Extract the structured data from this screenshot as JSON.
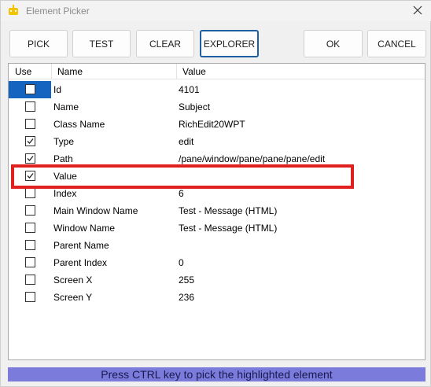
{
  "window": {
    "title": "Element Picker",
    "app_icon": "robot-icon",
    "close_icon": "close-icon"
  },
  "toolbar": {
    "pick_label": "PICK",
    "test_label": "TEST",
    "clear_label": "CLEAR",
    "explorer_label": "EXPLORER",
    "ok_label": "OK",
    "cancel_label": "CANCEL",
    "active": "EXPLORER"
  },
  "table": {
    "headers": {
      "use": "Use",
      "name": "Name",
      "value": "Value"
    },
    "rows": [
      {
        "name": "Id",
        "value": "4101",
        "checked": false,
        "selected": true
      },
      {
        "name": "Name",
        "value": "Subject",
        "checked": false,
        "selected": false
      },
      {
        "name": "Class Name",
        "value": "RichEdit20WPT",
        "checked": false,
        "selected": false
      },
      {
        "name": "Type",
        "value": "edit",
        "checked": true,
        "selected": false
      },
      {
        "name": "Path",
        "value": "/pane/window/pane/pane/pane/edit",
        "checked": true,
        "selected": false
      },
      {
        "name": "Value",
        "value": "",
        "checked": true,
        "selected": false
      },
      {
        "name": "Index",
        "value": "6",
        "checked": false,
        "selected": false
      },
      {
        "name": "Main Window Name",
        "value": "Test - Message (HTML)",
        "checked": false,
        "selected": false
      },
      {
        "name": "Window Name",
        "value": "Test - Message (HTML)",
        "checked": false,
        "selected": false
      },
      {
        "name": "Parent Name",
        "value": "",
        "checked": false,
        "selected": false
      },
      {
        "name": "Parent Index",
        "value": "0",
        "checked": false,
        "selected": false
      },
      {
        "name": "Screen X",
        "value": "255",
        "checked": false,
        "selected": false
      },
      {
        "name": "Screen Y",
        "value": "236",
        "checked": false,
        "selected": false
      }
    ]
  },
  "status": {
    "message": "Press CTRL key to pick the highlighted element"
  },
  "colors": {
    "status_bg": "#7b7bdb",
    "highlight": "#e0201e",
    "selection": "#1565c0",
    "active_border": "#1e5fa0"
  }
}
